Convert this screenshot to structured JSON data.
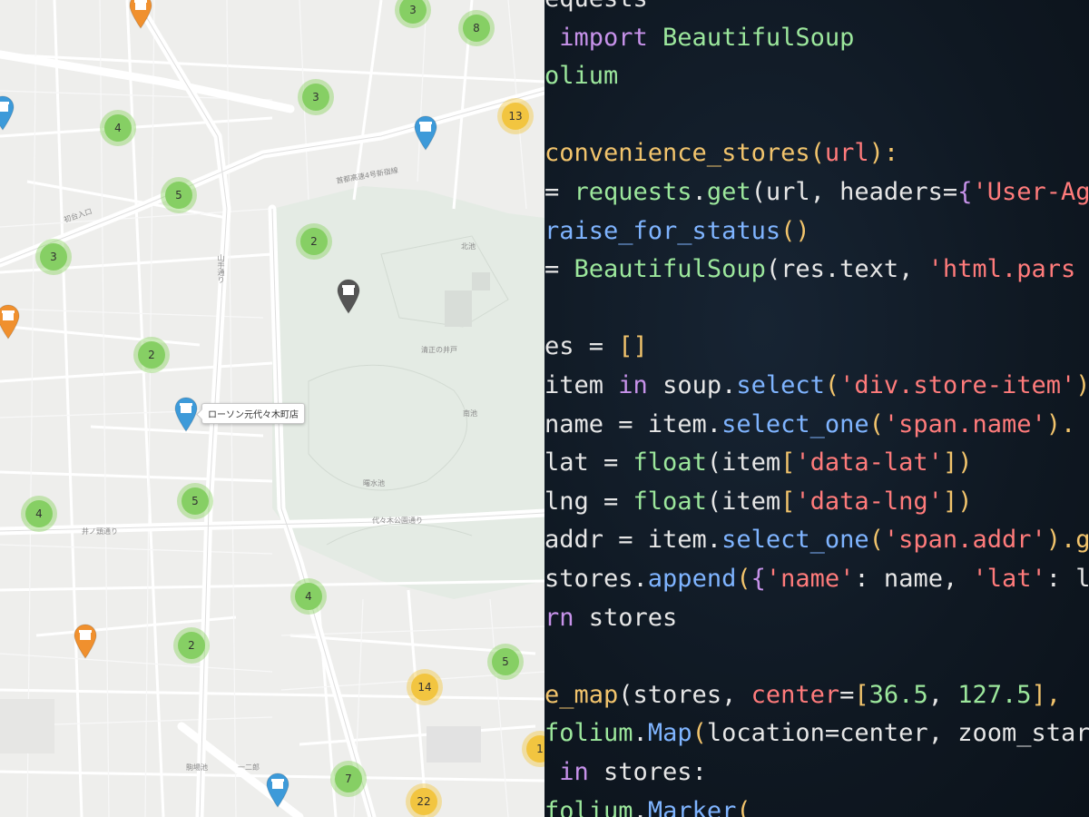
{
  "colors": {
    "cluster_green": "#86cf64",
    "cluster_yellow": "#f2c540",
    "marker_blue": "#3d9ad9",
    "marker_orange": "#f0902e",
    "marker_gray": "#555555",
    "code_bg": "#0f1822",
    "code_keyword": "#c792ea",
    "code_function": "#f2c46c",
    "code_class": "#9ce79c",
    "code_string": "#ff7b7b",
    "code_method": "#7fb4ff",
    "code_plain": "#e6e6e6"
  },
  "map": {
    "clusters": [
      {
        "label": "3",
        "color": "green"
      },
      {
        "label": "8",
        "color": "green"
      },
      {
        "label": "3",
        "color": "green"
      },
      {
        "label": "13",
        "color": "yellow"
      },
      {
        "label": "4",
        "color": "green"
      },
      {
        "label": "5",
        "color": "green"
      },
      {
        "label": "2",
        "color": "green"
      },
      {
        "label": "3",
        "color": "green"
      },
      {
        "label": "2",
        "color": "green"
      },
      {
        "label": "4",
        "color": "green"
      },
      {
        "label": "5",
        "color": "green"
      },
      {
        "label": "4",
        "color": "green"
      },
      {
        "label": "2",
        "color": "green"
      },
      {
        "label": "5",
        "color": "green"
      },
      {
        "label": "14",
        "color": "yellow"
      },
      {
        "label": "7",
        "color": "green"
      },
      {
        "label": "22",
        "color": "yellow"
      },
      {
        "label": "1",
        "color": "yellow"
      }
    ],
    "markers": [
      {
        "icon": "store-icon",
        "color": "orange"
      },
      {
        "icon": "store-icon",
        "color": "blue"
      },
      {
        "icon": "store-icon",
        "color": "blue"
      },
      {
        "icon": "store-icon",
        "color": "gray"
      },
      {
        "icon": "store-icon",
        "color": "orange"
      },
      {
        "icon": "store-icon",
        "color": "blue"
      },
      {
        "icon": "store-icon",
        "color": "orange"
      },
      {
        "icon": "store-icon",
        "color": "blue"
      }
    ],
    "tooltip": "ローソン元代々木町店",
    "labels": [
      "北池",
      "清正の井戸",
      "南池",
      "曙水池",
      "代々木公園通り",
      "井ノ頭通り",
      "首都高速4号新宿線",
      "初台入口",
      "駒場池",
      "一二郎",
      "山手通り"
    ]
  },
  "code": {
    "lines": [
      [
        {
          "t": "equests",
          "c": "plain"
        }
      ],
      [
        {
          "t": " import ",
          "c": "keyword"
        },
        {
          "t": "BeautifulSoup",
          "c": "class"
        }
      ],
      [
        {
          "t": "olium",
          "c": "class"
        }
      ],
      [],
      [
        {
          "t": "convenience_stores",
          "c": "function"
        },
        {
          "t": "(",
          "c": "function"
        },
        {
          "t": "url",
          "c": "string"
        },
        {
          "t": "):",
          "c": "function"
        }
      ],
      [
        {
          "t": "= ",
          "c": "plain"
        },
        {
          "t": "requests",
          "c": "class"
        },
        {
          "t": ".",
          "c": "plain"
        },
        {
          "t": "get",
          "c": "class"
        },
        {
          "t": "(url, headers=",
          "c": "plain"
        },
        {
          "t": "{",
          "c": "keyword"
        },
        {
          "t": "'User-Age",
          "c": "string"
        }
      ],
      [
        {
          "t": "raise_for_status",
          "c": "method"
        },
        {
          "t": "()",
          "c": "function"
        }
      ],
      [
        {
          "t": "= ",
          "c": "plain"
        },
        {
          "t": "BeautifulSoup",
          "c": "class"
        },
        {
          "t": "(res.text, ",
          "c": "plain"
        },
        {
          "t": "'html.pars",
          "c": "string"
        }
      ],
      [],
      [
        {
          "t": "es = ",
          "c": "plain"
        },
        {
          "t": "[]",
          "c": "function"
        }
      ],
      [
        {
          "t": "item ",
          "c": "plain"
        },
        {
          "t": "in ",
          "c": "keyword"
        },
        {
          "t": "soup.",
          "c": "plain"
        },
        {
          "t": "select",
          "c": "method"
        },
        {
          "t": "(",
          "c": "function"
        },
        {
          "t": "'div.store-item'",
          "c": "string"
        },
        {
          "t": ")",
          "c": "function"
        }
      ],
      [
        {
          "t": "name = item.",
          "c": "plain"
        },
        {
          "t": "select_one",
          "c": "method"
        },
        {
          "t": "(",
          "c": "function"
        },
        {
          "t": "'span.name'",
          "c": "string"
        },
        {
          "t": ").",
          "c": "function"
        }
      ],
      [
        {
          "t": "lat = ",
          "c": "plain"
        },
        {
          "t": "float",
          "c": "class"
        },
        {
          "t": "(item",
          "c": "plain"
        },
        {
          "t": "[",
          "c": "function"
        },
        {
          "t": "'data-lat'",
          "c": "string"
        },
        {
          "t": "])",
          "c": "function"
        }
      ],
      [
        {
          "t": "lng = ",
          "c": "plain"
        },
        {
          "t": "float",
          "c": "class"
        },
        {
          "t": "(item",
          "c": "plain"
        },
        {
          "t": "[",
          "c": "function"
        },
        {
          "t": "'data-lng'",
          "c": "string"
        },
        {
          "t": "])",
          "c": "function"
        }
      ],
      [
        {
          "t": "addr = item.",
          "c": "plain"
        },
        {
          "t": "select_one",
          "c": "method"
        },
        {
          "t": "(",
          "c": "function"
        },
        {
          "t": "'span.addr'",
          "c": "string"
        },
        {
          "t": ").g",
          "c": "function"
        }
      ],
      [
        {
          "t": "stores.",
          "c": "plain"
        },
        {
          "t": "append",
          "c": "method"
        },
        {
          "t": "(",
          "c": "function"
        },
        {
          "t": "{",
          "c": "keyword"
        },
        {
          "t": "'name'",
          "c": "string"
        },
        {
          "t": ": name, ",
          "c": "plain"
        },
        {
          "t": "'lat'",
          "c": "string"
        },
        {
          "t": ": l",
          "c": "plain"
        }
      ],
      [
        {
          "t": "rn ",
          "c": "keyword"
        },
        {
          "t": "stores",
          "c": "plain"
        }
      ],
      [],
      [
        {
          "t": "e_map",
          "c": "function"
        },
        {
          "t": "(stores, ",
          "c": "plain"
        },
        {
          "t": "center",
          "c": "string"
        },
        {
          "t": "=",
          "c": "plain"
        },
        {
          "t": "[",
          "c": "function"
        },
        {
          "t": "36.5",
          "c": "class"
        },
        {
          "t": ", ",
          "c": "plain"
        },
        {
          "t": "127.5",
          "c": "class"
        },
        {
          "t": "], ",
          "c": "function"
        }
      ],
      [
        {
          "t": "folium",
          "c": "class"
        },
        {
          "t": ".",
          "c": "plain"
        },
        {
          "t": "Map",
          "c": "method"
        },
        {
          "t": "(",
          "c": "function"
        },
        {
          "t": "location=center, zoom_star",
          "c": "plain"
        }
      ],
      [
        {
          "t": " in ",
          "c": "keyword"
        },
        {
          "t": "stores:",
          "c": "plain"
        }
      ],
      [
        {
          "t": "folium",
          "c": "class"
        },
        {
          "t": ".",
          "c": "plain"
        },
        {
          "t": "Marker",
          "c": "method"
        },
        {
          "t": "(",
          "c": "function"
        }
      ]
    ]
  }
}
